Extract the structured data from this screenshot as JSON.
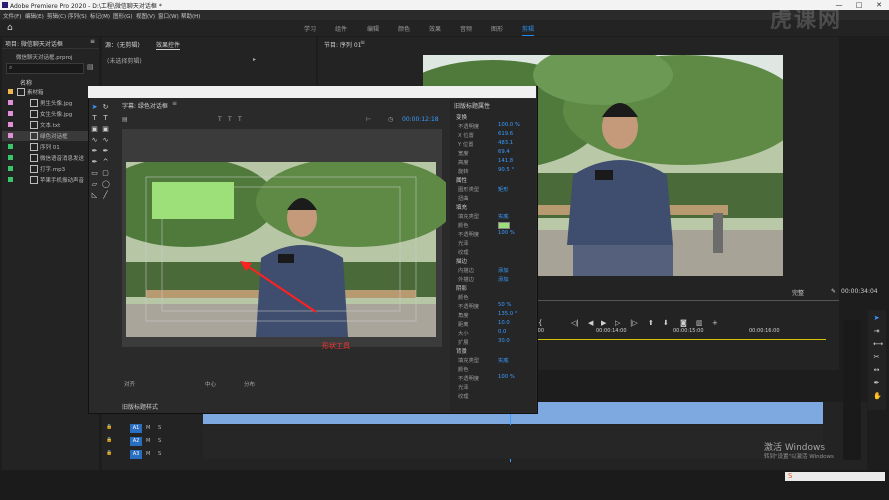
{
  "app": {
    "title": "Adobe Premiere Pro 2020 - D:\\工程\\微信聊天对话框 *",
    "win_controls": [
      "—",
      "□",
      "✕"
    ]
  },
  "menus": [
    "文件(F)",
    "编辑(E)",
    "剪辑(C)",
    "序列(S)",
    "标记(M)",
    "图形(G)",
    "视图(V)",
    "窗口(W)",
    "帮助(H)"
  ],
  "workspaces": [
    "学习",
    "组件",
    "编辑",
    "颜色",
    "效果",
    "音频",
    "图形",
    "剪辑"
  ],
  "workspace_active": "剪辑",
  "project": {
    "tab": "项目: 微信聊天对话框",
    "menu_icon": "≡",
    "file": "微信聊天对话框.prproj",
    "name_header": "名称",
    "items": [
      {
        "label": "素材箱",
        "color": "#f0b84a",
        "icon": "folder-icon"
      },
      {
        "label": "男生头像.jpg",
        "color": "#e28fd8",
        "icon": "image-icon"
      },
      {
        "label": "女生头像.jpg",
        "color": "#e28fd8",
        "icon": "image-icon"
      },
      {
        "label": "文本.txt",
        "color": "#e28fd8",
        "icon": "file-icon"
      },
      {
        "label": "绿色对话框",
        "color": "#e28fd8",
        "icon": "title-icon"
      },
      {
        "label": "序列 01",
        "color": "#39c56a",
        "icon": "sequence-icon"
      },
      {
        "label": "微信语音消息发送",
        "color": "#39c56a",
        "icon": "audio-icon"
      },
      {
        "label": "打字.mp3",
        "color": "#39c56a",
        "icon": "audio-icon"
      },
      {
        "label": "苹果手机振动声音",
        "color": "#39c56a",
        "icon": "audio-icon"
      }
    ]
  },
  "source": {
    "tab": "源：(无剪辑)",
    "effects_tab": "效果控件",
    "no_clip": "(未选择剪辑)"
  },
  "program": {
    "tab": "节目: 序列 01",
    "timecode": "00:00:34:04",
    "fit": "完整"
  },
  "titler": {
    "header": "字幕: 绿色对话框",
    "timecode": "00:00:12:18",
    "annotation": "形状工具",
    "align_labels": [
      "对齐",
      "中心",
      "分布"
    ],
    "styles_header": "旧版标题样式",
    "props_header": "旧版标题属性",
    "props": [
      {
        "label": "变换",
        "value": "",
        "section": true
      },
      {
        "label": "不透明度",
        "value": "100.0 %"
      },
      {
        "label": "X 位置",
        "value": "619.6"
      },
      {
        "label": "Y 位置",
        "value": "483.1"
      },
      {
        "label": "宽度",
        "value": "69.4"
      },
      {
        "label": "高度",
        "value": "141.8"
      },
      {
        "label": "旋转",
        "value": "90.5 °"
      },
      {
        "label": "属性",
        "value": "",
        "section": true
      },
      {
        "label": "图形类型",
        "value": "矩形"
      },
      {
        "label": "扭曲",
        "value": ""
      },
      {
        "label": "填充",
        "value": "",
        "section": true
      },
      {
        "label": "填充类型",
        "value": "实底"
      },
      {
        "label": "颜色",
        "value": ""
      },
      {
        "label": "不透明度",
        "value": "100 %"
      },
      {
        "label": "光泽",
        "value": ""
      },
      {
        "label": "纹理",
        "value": ""
      },
      {
        "label": "描边",
        "value": "",
        "section": true
      },
      {
        "label": "内描边",
        "value": "添加"
      },
      {
        "label": "外描边",
        "value": "添加"
      },
      {
        "label": "阴影",
        "value": "",
        "section": true
      },
      {
        "label": "颜色",
        "value": ""
      },
      {
        "label": "不透明度",
        "value": "50 %"
      },
      {
        "label": "角度",
        "value": "135.0 °"
      },
      {
        "label": "距离",
        "value": "10.0"
      },
      {
        "label": "大小",
        "value": "0.0"
      },
      {
        "label": "扩展",
        "value": "30.0"
      },
      {
        "label": "背景",
        "value": "",
        "section": true
      },
      {
        "label": "填充类型",
        "value": "实底"
      },
      {
        "label": "颜色",
        "value": ""
      },
      {
        "label": "不透明度",
        "value": "100 %"
      },
      {
        "label": "光泽",
        "value": ""
      },
      {
        "label": "纹理",
        "value": ""
      }
    ],
    "fill_color": "#9de07a"
  },
  "timeline": {
    "ticks": [
      "00:00:14:00",
      "00:00:15:00",
      "00:00:16:00"
    ],
    "tracks": [
      "A1",
      "A2",
      "A3"
    ],
    "video_track_label": "视频 1"
  },
  "activation": {
    "line1": "激活 Windows",
    "line2": "转到\"设置\"以激活 Windows"
  },
  "watermark": "虎课网"
}
